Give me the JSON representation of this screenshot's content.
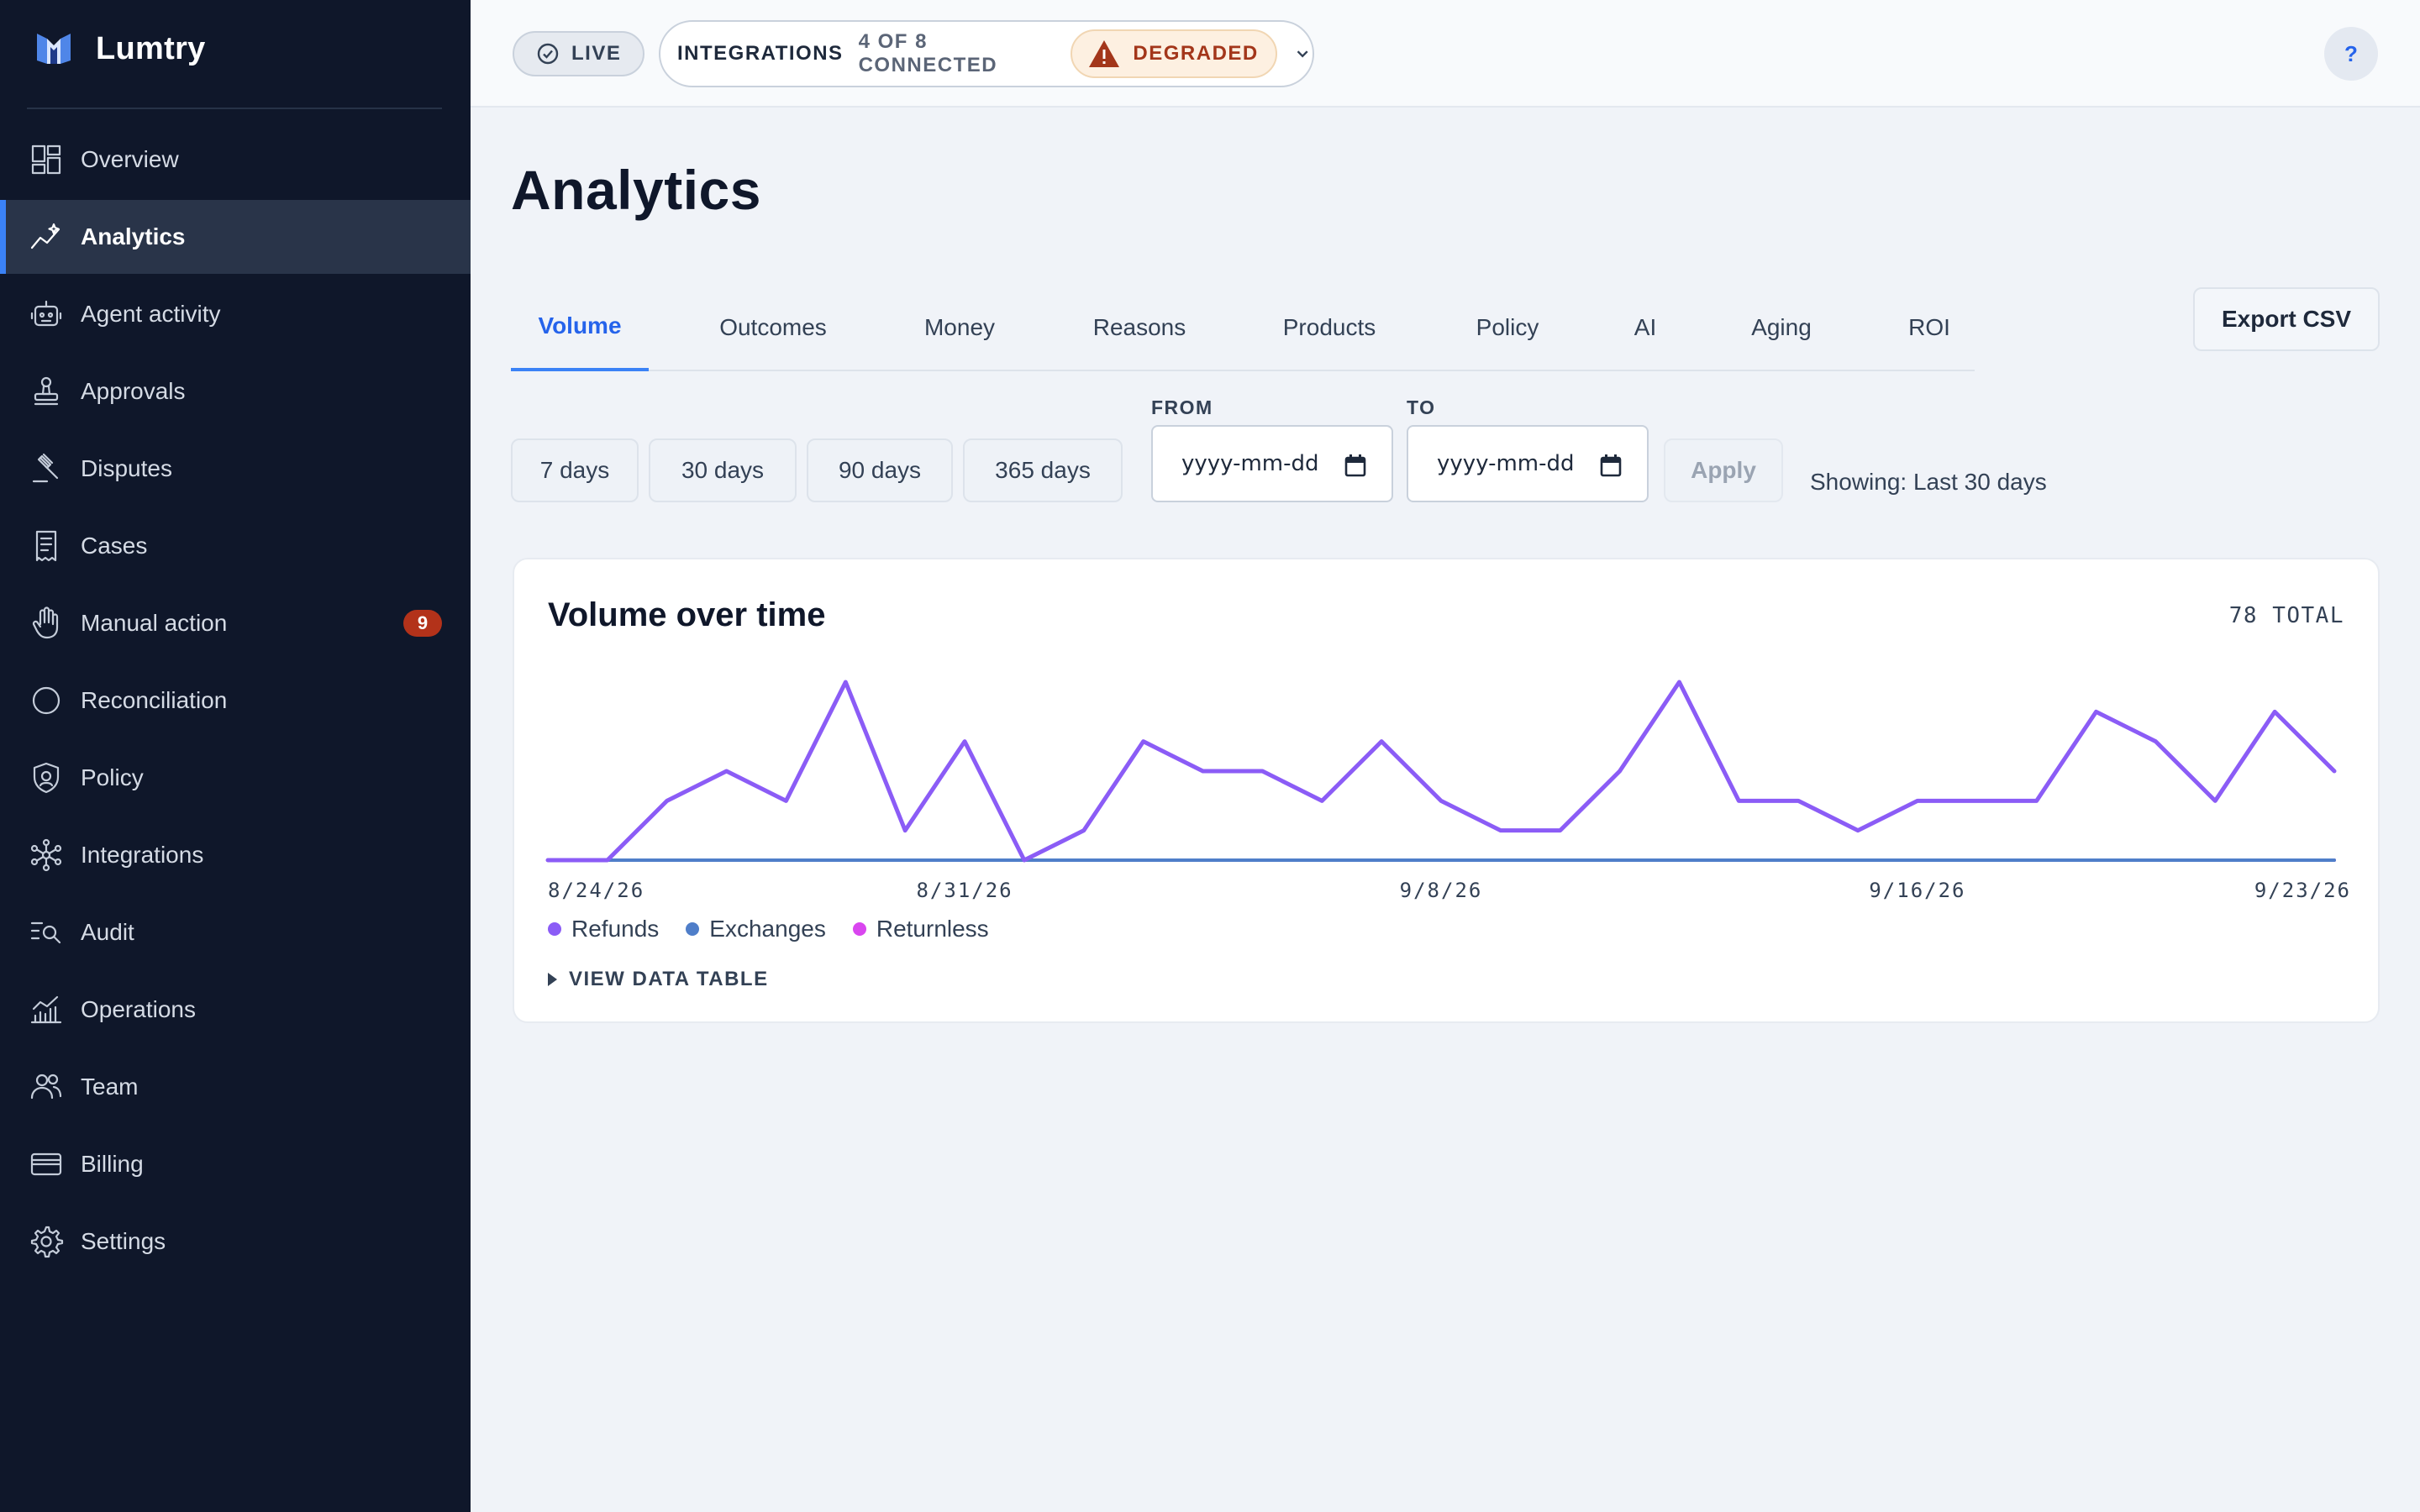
{
  "app": {
    "name": "Lumtry"
  },
  "sidebar": {
    "items": [
      {
        "label": "Overview",
        "icon": "dashboard-icon"
      },
      {
        "label": "Analytics",
        "icon": "trend-icon",
        "active": true
      },
      {
        "label": "Agent activity",
        "icon": "robot-icon"
      },
      {
        "label": "Approvals",
        "icon": "stamp-icon"
      },
      {
        "label": "Disputes",
        "icon": "gavel-icon"
      },
      {
        "label": "Cases",
        "icon": "receipt-icon"
      },
      {
        "label": "Manual action",
        "icon": "hand-icon",
        "badge": "9"
      },
      {
        "label": "Reconciliation",
        "icon": "circle-icon"
      },
      {
        "label": "Policy",
        "icon": "shield-icon"
      },
      {
        "label": "Integrations",
        "icon": "network-icon"
      },
      {
        "label": "Audit",
        "icon": "list-search-icon"
      },
      {
        "label": "Operations",
        "icon": "chart-bars-icon"
      },
      {
        "label": "Team",
        "icon": "users-icon"
      },
      {
        "label": "Billing",
        "icon": "credit-card-icon"
      },
      {
        "label": "Settings",
        "icon": "gear-icon"
      }
    ]
  },
  "topbar": {
    "live_label": "LIVE",
    "integrations_label": "INTEGRATIONS",
    "integrations_count": "4 OF 8 CONNECTED",
    "status_label": "DEGRADED",
    "help_label": "?"
  },
  "page": {
    "title": "Analytics",
    "tabs": [
      "Volume",
      "Outcomes",
      "Money",
      "Reasons",
      "Products",
      "Policy",
      "AI",
      "Aging",
      "ROI"
    ],
    "active_tab": "Volume",
    "export_label": "Export CSV",
    "ranges": [
      "7 days",
      "30 days",
      "90 days",
      "365 days"
    ],
    "from_label": "FROM",
    "to_label": "TO",
    "date_placeholder": "yyyy-mm-dd",
    "apply_label": "Apply",
    "showing_text": "Showing: Last 30 days"
  },
  "colors": {
    "accent": "#3b82f6",
    "refunds": "#8b5cf6",
    "exchanges": "#4f7ec9",
    "returnless": "#d946ef",
    "sidebar_bg": "#0f172a",
    "badge": "#b3321a"
  },
  "chart_data": {
    "type": "line",
    "title": "Volume over time",
    "total_label": "78 TOTAL",
    "x_tick_labels": [
      "8/24/26",
      "8/31/26",
      "9/8/26",
      "9/16/26",
      "9/23/26"
    ],
    "x": [
      "8/24/26",
      "8/25/26",
      "8/26/26",
      "8/27/26",
      "8/28/26",
      "8/29/26",
      "8/30/26",
      "8/31/26",
      "9/1/26",
      "9/2/26",
      "9/3/26",
      "9/4/26",
      "9/5/26",
      "9/6/26",
      "9/7/26",
      "9/8/26",
      "9/9/26",
      "9/10/26",
      "9/11/26",
      "9/12/26",
      "9/13/26",
      "9/14/26",
      "9/15/26",
      "9/16/26",
      "9/17/26",
      "9/18/26",
      "9/19/26",
      "9/20/26",
      "9/21/26",
      "9/22/26",
      "9/23/26"
    ],
    "series": [
      {
        "name": "Refunds",
        "values": [
          0,
          0,
          2,
          3,
          2,
          6,
          1,
          4,
          0,
          1,
          4,
          3,
          3,
          2,
          4,
          2,
          1,
          1,
          3,
          6,
          2,
          2,
          1,
          2,
          2,
          2,
          5,
          4,
          2,
          5,
          3
        ]
      },
      {
        "name": "Exchanges",
        "values": [
          0,
          0,
          0,
          0,
          0,
          0,
          0,
          0,
          0,
          0,
          0,
          0,
          0,
          0,
          0,
          0,
          0,
          0,
          0,
          0,
          0,
          0,
          0,
          0,
          0,
          0,
          0,
          0,
          0,
          0,
          0
        ]
      },
      {
        "name": "Returnless",
        "values": [
          0,
          0,
          0,
          0,
          0,
          0,
          0,
          0,
          0,
          0,
          0,
          0,
          0,
          0,
          0,
          0,
          0,
          0,
          0,
          0,
          0,
          0,
          0,
          0,
          0,
          0,
          0,
          0,
          0,
          0,
          0
        ]
      }
    ],
    "ylim": [
      0,
      6
    ],
    "legend": "bottom-left",
    "grid": false,
    "table_toggle_label": "VIEW DATA TABLE"
  }
}
